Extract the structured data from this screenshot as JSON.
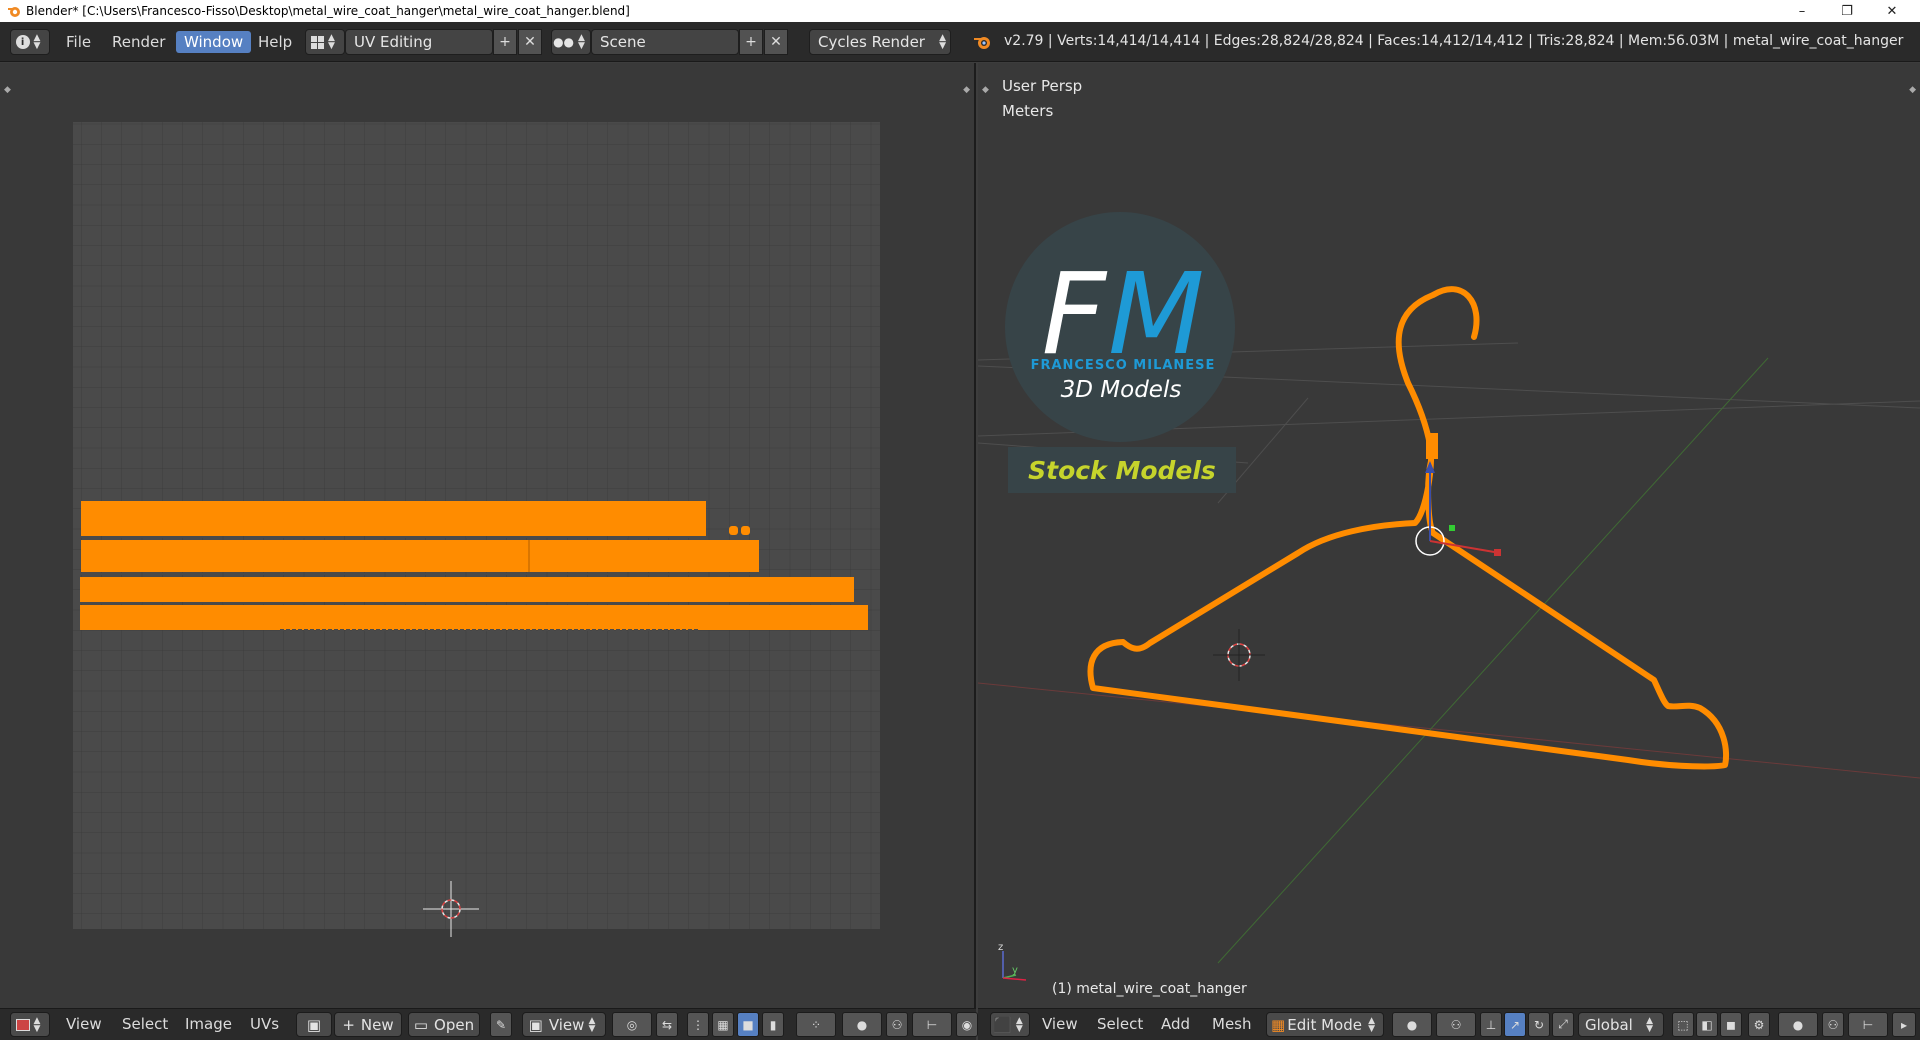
{
  "window": {
    "title": "Blender* [C:\\Users\\Francesco-Fisso\\Desktop\\metal_wire_coat_hanger\\metal_wire_coat_hanger.blend]",
    "controls": {
      "minimize": "–",
      "restore": "❐",
      "close": "✕"
    }
  },
  "top_header": {
    "menus": [
      "File",
      "Render",
      "Window",
      "Help"
    ],
    "active_menu": "Window",
    "screen_layout": "UV Editing",
    "scene": "Scene",
    "render_engine": "Cycles Render",
    "stats": "v2.79 | Verts:14,414/14,414 | Edges:28,824/28,824 | Faces:14,412/14,412 | Tris:28,824 | Mem:56.03M | metal_wire_coat_hanger"
  },
  "viewport": {
    "view_name": "User Persp",
    "units": "Meters",
    "object_label": "(1) metal_wire_coat_hanger",
    "watermark": {
      "initials_f": "F",
      "initials_m": "M",
      "name": "FRANCESCO MILANESE",
      "subtitle": "3D Models",
      "badge": "Stock Models"
    }
  },
  "uv_header": {
    "menus": [
      "View",
      "Select",
      "Image",
      "UVs"
    ],
    "new_label": "New",
    "open_label": "Open",
    "view_label": "View"
  },
  "viewport_header": {
    "menus": [
      "View",
      "Select",
      "Add",
      "Mesh"
    ],
    "mode": "Edit Mode",
    "orientation": "Global"
  },
  "colors": {
    "accent": "#5680c2",
    "selection_orange": "#ff8c00",
    "background": "#393939"
  }
}
